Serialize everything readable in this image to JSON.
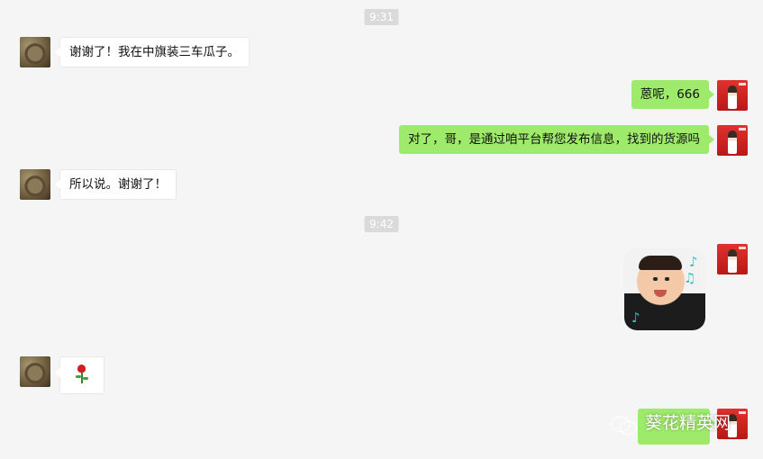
{
  "timestamps": [
    "9:31",
    "9:42"
  ],
  "messages": [
    {
      "side": "left",
      "text": "谢谢了！我在中旗装三车瓜子。"
    },
    {
      "side": "right",
      "text": "蒽呢，666"
    },
    {
      "side": "right",
      "text": "对了，哥，是通过咱平台帮您发布信息，找到的货源吗"
    },
    {
      "side": "left",
      "text": "所以说。谢谢了！"
    },
    {
      "side": "right",
      "type": "sticker",
      "sticker": "smiling-baby-sticker"
    },
    {
      "side": "left",
      "type": "emoji",
      "emoji": "rose"
    },
    {
      "side": "right",
      "type": "partial-bubble"
    }
  ],
  "watermark": {
    "text": "葵花精英网",
    "icon": "wechat-icon"
  },
  "colors": {
    "background": "#f5f5f5",
    "right_bubble": "#9eea6a",
    "left_bubble": "#ffffff",
    "timestamp_bg": "#dadada"
  }
}
